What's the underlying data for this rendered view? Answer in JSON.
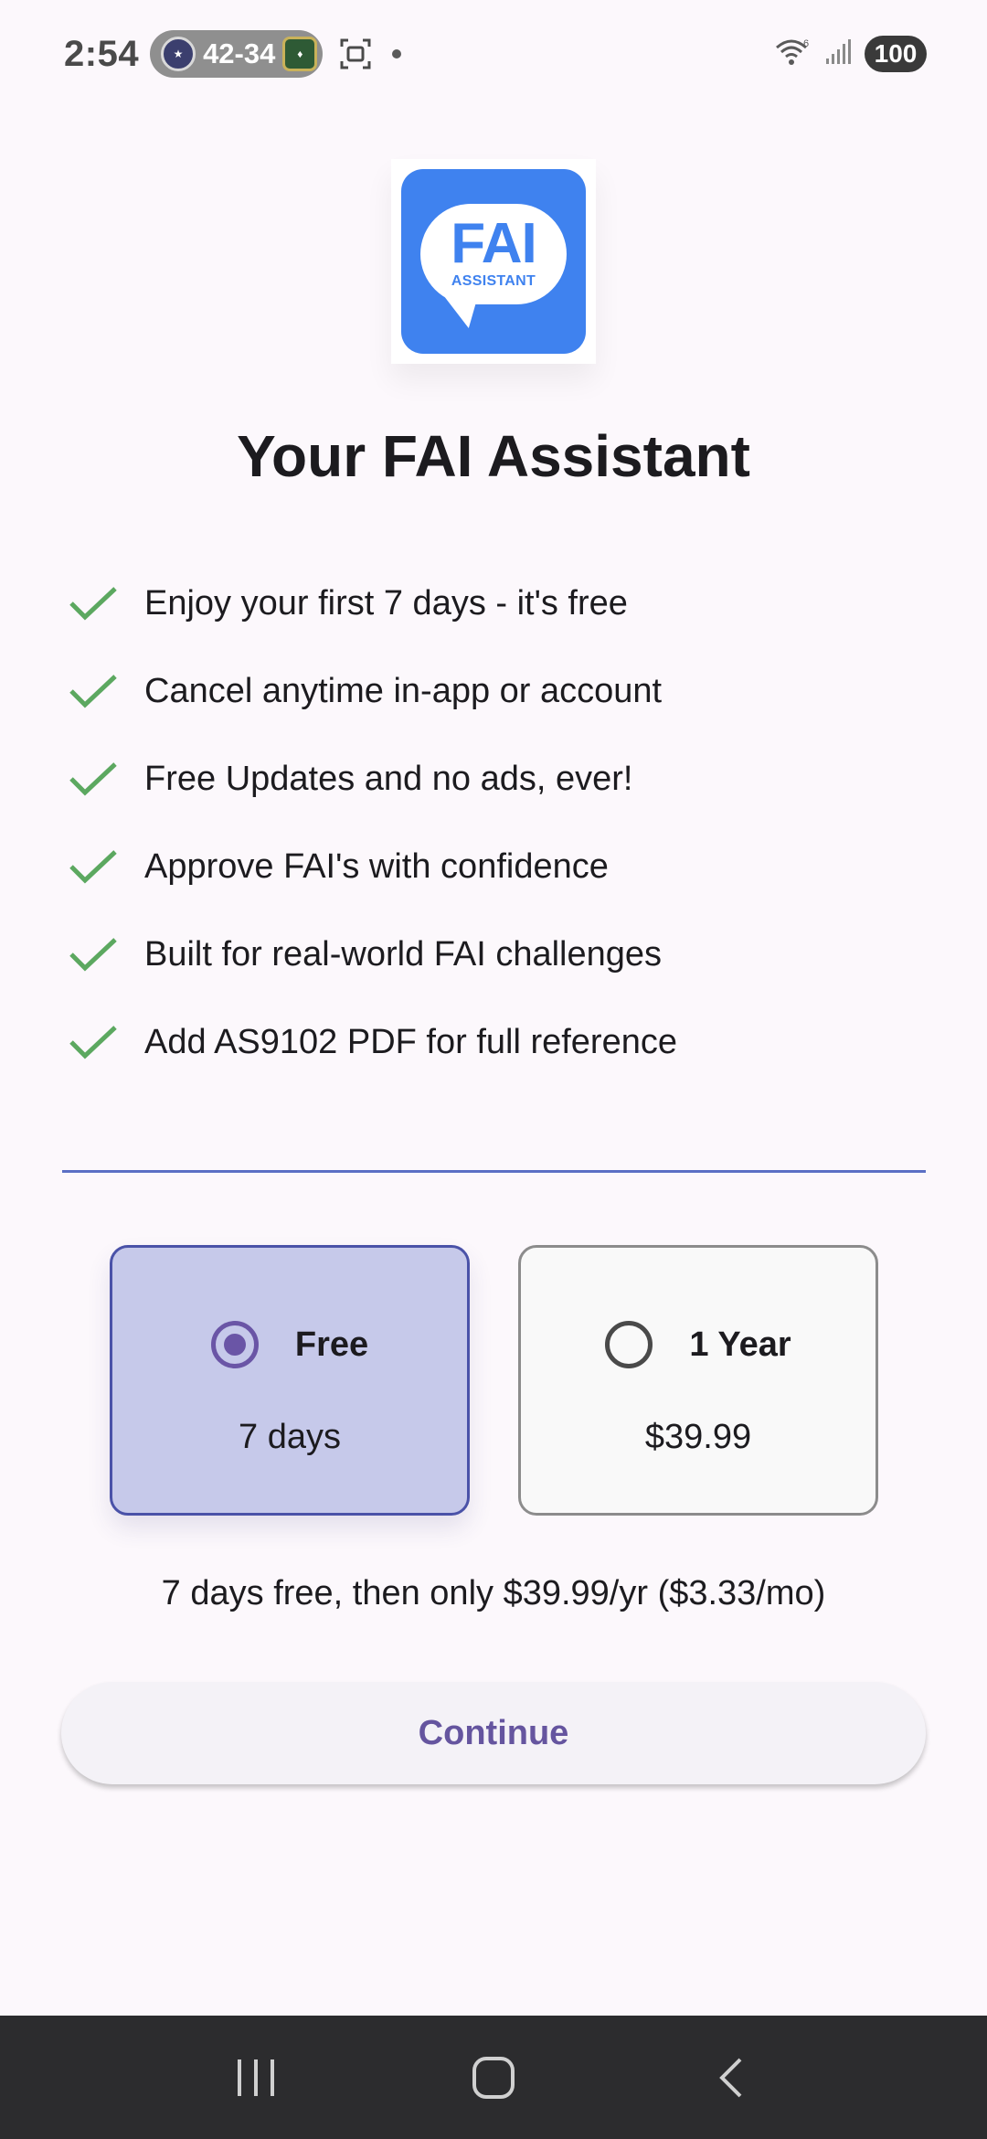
{
  "status_bar": {
    "time": "2:54",
    "score": "42-34",
    "battery": "100",
    "icons": [
      "team-logo-home",
      "team-logo-away",
      "screenshot-icon",
      "dot",
      "wifi-icon",
      "signal-icon",
      "battery-icon"
    ]
  },
  "logo": {
    "main": "FAI",
    "sub": "ASSISTANT",
    "color": "#3f82ef"
  },
  "title": "Your FAI Assistant",
  "features": [
    "Enjoy your first 7 days - it's free",
    "Cancel anytime in-app or account",
    "Free Updates and no ads, ever!",
    "Approve FAI's with confidence",
    "Built for real-world FAI challenges",
    "Add AS9102 PDF for full reference"
  ],
  "plans": {
    "free": {
      "name": "Free",
      "price": "7 days",
      "selected": true
    },
    "year": {
      "name": "1 Year",
      "price": "$39.99",
      "selected": false
    }
  },
  "terms": "7 days free, then only $39.99/yr ($3.33/mo)",
  "continue_label": "Continue",
  "colors": {
    "accent": "#65559f",
    "selected_plan_bg": "#c6c9ea",
    "check": "#5ca860",
    "divider": "#5b6fc4"
  },
  "nav": {
    "icons": [
      "recent-apps-icon",
      "home-icon",
      "back-icon"
    ]
  }
}
